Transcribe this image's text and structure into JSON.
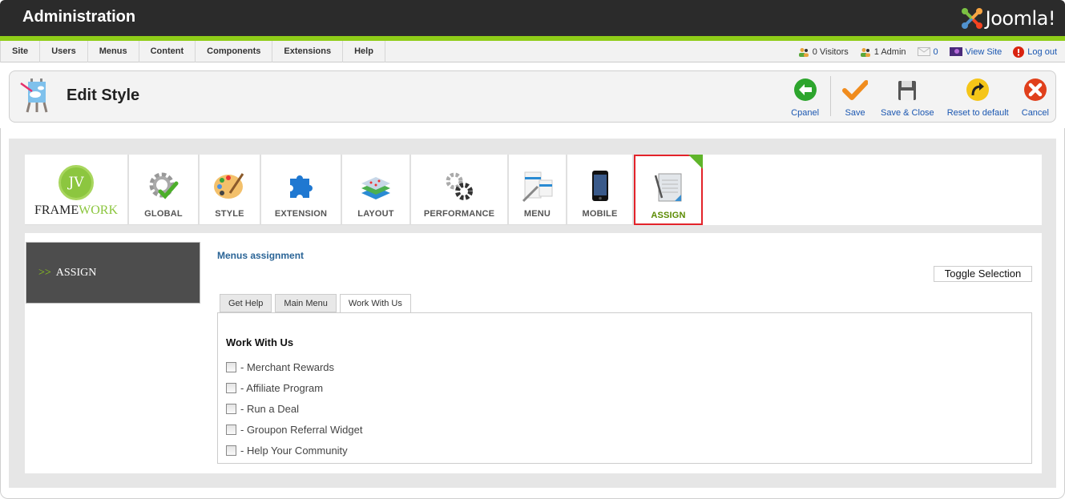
{
  "header": {
    "title": "Administration",
    "logo_text": "Joomla!"
  },
  "menu": {
    "items": [
      "Site",
      "Users",
      "Menus",
      "Content",
      "Components",
      "Extensions",
      "Help"
    ]
  },
  "status": {
    "visitors": "0 Visitors",
    "admins": "1 Admin",
    "messages": "0",
    "view_site": "View Site",
    "logout": "Log out"
  },
  "toolbar": {
    "page_title": "Edit Style",
    "buttons": [
      {
        "label": "Cpanel",
        "icon": "back-arrow-icon",
        "color": "#2da52d"
      },
      {
        "label": "Save",
        "icon": "checkmark-icon",
        "color": "#f08c1e"
      },
      {
        "label": "Save & Close",
        "icon": "floppy-disk-icon",
        "color": "#555555"
      },
      {
        "label": "Reset to default",
        "icon": "reset-arrow-icon",
        "color": "#f5c518"
      },
      {
        "label": "Cancel",
        "icon": "cancel-x-icon",
        "color": "#e0401c"
      }
    ]
  },
  "framework": {
    "logo_initials": "JV",
    "logo_text_dark": "FRAME",
    "logo_text_green": "WORK"
  },
  "icon_tabs": [
    {
      "label": "GLOBAL",
      "icon": "gear-check-icon"
    },
    {
      "label": "STYLE",
      "icon": "palette-icon"
    },
    {
      "label": "EXTENSION",
      "icon": "puzzle-icon"
    },
    {
      "label": "LAYOUT",
      "icon": "layers-icon"
    },
    {
      "label": "PERFORMANCE",
      "icon": "gears-icon"
    },
    {
      "label": "MENU",
      "icon": "menu-pen-icon"
    },
    {
      "label": "MOBILE",
      "icon": "phone-icon"
    },
    {
      "label": "ASSIGN",
      "icon": "document-pen-icon",
      "active": true
    }
  ],
  "content": {
    "side_arrows": ">>",
    "side_label": "ASSIGN",
    "title": "Menus assignment",
    "toggle_label": "Toggle Selection",
    "tabs": [
      {
        "label": "Get Help"
      },
      {
        "label": "Main Menu"
      },
      {
        "label": "Work With Us",
        "active": true
      }
    ],
    "panel_heading": "Work With Us",
    "items": [
      {
        "label": "- Merchant Rewards",
        "checked": false
      },
      {
        "label": "- Affiliate Program",
        "checked": false
      },
      {
        "label": "- Run a Deal",
        "checked": false
      },
      {
        "label": "- Groupon Referral Widget",
        "checked": false
      },
      {
        "label": "- Help Your Community",
        "checked": false
      }
    ]
  },
  "colors": {
    "accent_green": "#8fcd18",
    "header_bg": "#2b2b2b",
    "link_blue": "#1b57b1",
    "active_tab_border": "#e3232a"
  }
}
